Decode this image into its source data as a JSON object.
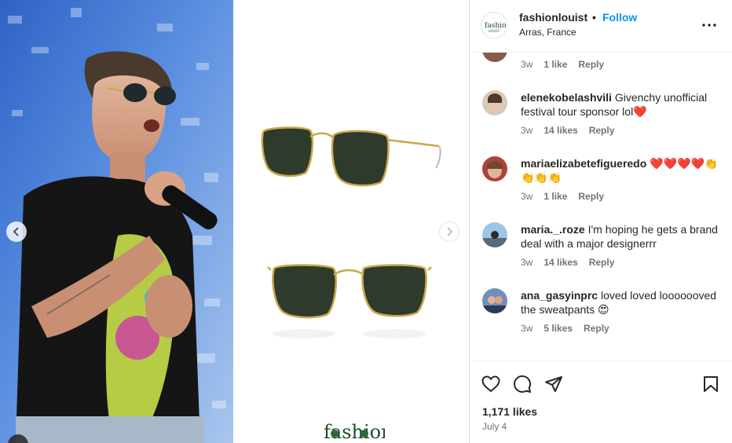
{
  "post": {
    "username": "fashionlouist",
    "separator": "•",
    "follow_label": "Follow",
    "location": "Arras, France",
    "likes": "1,171 likes",
    "date": "July 4"
  },
  "media": {
    "brand_logo_text": "fashion"
  },
  "comments": [
    {
      "username": "",
      "text": "",
      "time": "3w",
      "likes": "1 like",
      "reply": "Reply"
    },
    {
      "username": "elenekobelashvili",
      "text": "Givenchy unofficial festival tour sponsor lol❤️",
      "time": "3w",
      "likes": "14 likes",
      "reply": "Reply"
    },
    {
      "username": "mariaelizabetefigueredo",
      "text": "❤️❤️❤️❤️👏👏👏👏",
      "time": "3w",
      "likes": "1 like",
      "reply": "Reply"
    },
    {
      "username": "maria._.roze",
      "text": "I'm hoping he gets a brand deal with a major designerrr",
      "time": "3w",
      "likes": "14 likes",
      "reply": "Reply"
    },
    {
      "username": "ana_gasyinprc",
      "text": "loved loved looooooved the sweatpants 😍",
      "time": "3w",
      "likes": "5 likes",
      "reply": "Reply"
    }
  ],
  "icons": {
    "like": "heart-icon",
    "comment": "comment-icon",
    "share": "share-icon",
    "save": "bookmark-icon",
    "more": "more-icon"
  },
  "colors": {
    "follow": "#0095f6",
    "text": "#262626",
    "muted": "#737373"
  }
}
